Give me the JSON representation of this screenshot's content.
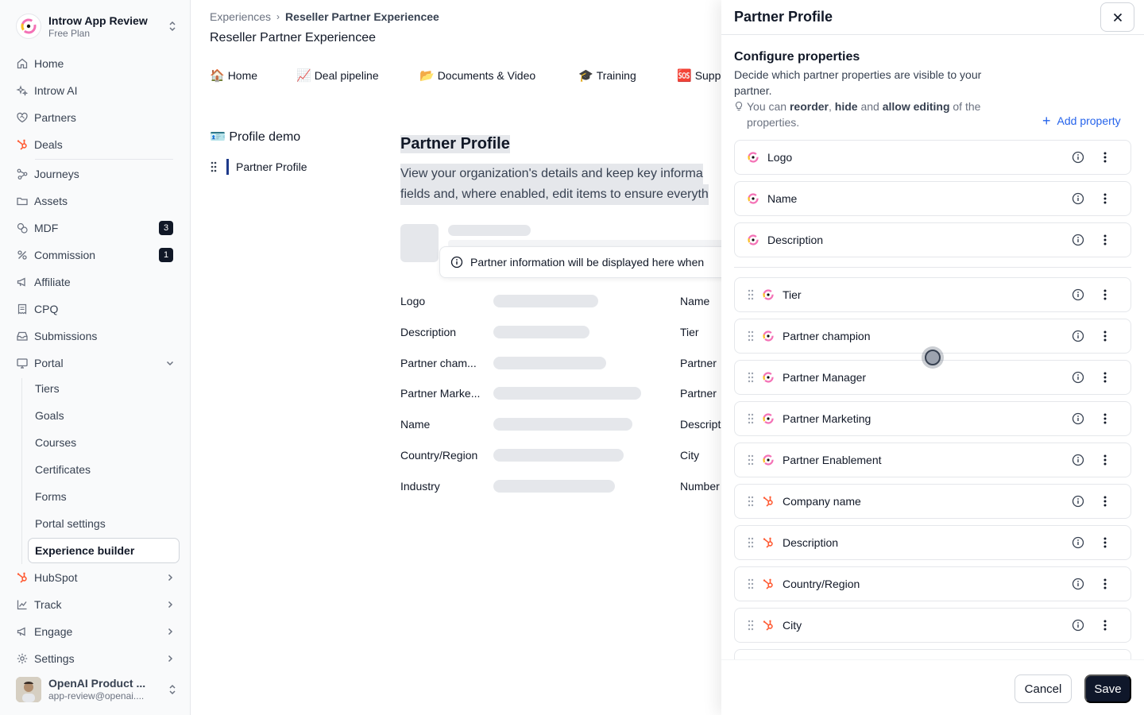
{
  "workspace": {
    "name": "Introw App Review",
    "plan": "Free Plan"
  },
  "sidebar": {
    "items": [
      {
        "label": "Home",
        "icon": "home-icon"
      },
      {
        "label": "Introw AI",
        "icon": "sparkle-icon"
      },
      {
        "label": "Partners",
        "icon": "handshake-icon"
      },
      {
        "label": "Deals",
        "icon": "hubspot-icon"
      },
      {
        "label": "Journeys",
        "icon": "journeys-icon"
      },
      {
        "label": "Assets",
        "icon": "folder-icon"
      },
      {
        "label": "MDF",
        "icon": "coins-icon",
        "badge": "3"
      },
      {
        "label": "Commission",
        "icon": "percent-icon",
        "badge": "1"
      },
      {
        "label": "Affiliate",
        "icon": "megaphone-icon"
      },
      {
        "label": "CPQ",
        "icon": "receipt-icon"
      },
      {
        "label": "Submissions",
        "icon": "inbox-icon"
      },
      {
        "label": "Portal",
        "icon": "monitor-icon"
      }
    ],
    "portal_sub": [
      "Tiers",
      "Goals",
      "Courses",
      "Certificates",
      "Forms",
      "Portal settings",
      "Experience builder"
    ],
    "bottom": [
      {
        "label": "HubSpot",
        "icon": "hubspot-icon"
      },
      {
        "label": "Track",
        "icon": "chart-icon"
      },
      {
        "label": "Engage",
        "icon": "megaphone-icon"
      },
      {
        "label": "Settings",
        "icon": "gear-icon"
      }
    ],
    "user": {
      "name": "OpenAI Product ...",
      "email": "app-review@openai...."
    }
  },
  "main": {
    "breadcrumb": {
      "parent": "Experiences",
      "current": "Reseller Partner Experiencee"
    },
    "title": "Reseller Partner Experiencee",
    "tabs": [
      {
        "emoji": "🏠",
        "label": "Home"
      },
      {
        "emoji": "📈",
        "label": "Deal pipeline"
      },
      {
        "emoji": "📂",
        "label": "Documents & Video"
      },
      {
        "emoji": "🎓",
        "label": "Training"
      },
      {
        "emoji": "🆘",
        "label": "Supp"
      }
    ],
    "left_panel": {
      "title_emoji": "🪪",
      "title": "Profile demo",
      "item": "Partner Profile"
    },
    "preview": {
      "title": "Partner Profile",
      "desc_line1": "View your organization's details and keep key informa",
      "desc_line2": "fields and, where enabled, edit items to ensure everyth",
      "info_message": "Partner information will be displayed here when",
      "fields_left": [
        "Logo",
        "Description",
        "Partner cham...",
        "Partner Marke...",
        "Name",
        "Country/Region",
        "Industry"
      ],
      "fields_right": [
        "Name",
        "Tier",
        "Partner",
        "Partner",
        "Descript",
        "City",
        "Number"
      ]
    }
  },
  "drawer": {
    "title": "Partner Profile",
    "config_title": "Configure properties",
    "config_desc": "Decide which partner properties are visible to your partner.",
    "hint": {
      "pre": "You can ",
      "reorder": "reorder",
      "mid1": ", ",
      "hide": "hide",
      "mid2": " and ",
      "allow": "allow editing",
      "post": " of the properties."
    },
    "add_property": "Add property",
    "fixed_properties": [
      {
        "label": "Logo",
        "source": "introw"
      },
      {
        "label": "Name",
        "source": "introw"
      },
      {
        "label": "Description",
        "source": "introw"
      }
    ],
    "properties": [
      {
        "label": "Tier",
        "source": "introw"
      },
      {
        "label": "Partner champion",
        "source": "introw"
      },
      {
        "label": "Partner Manager",
        "source": "introw"
      },
      {
        "label": "Partner Marketing",
        "source": "introw"
      },
      {
        "label": "Partner Enablement",
        "source": "introw"
      },
      {
        "label": "Company name",
        "source": "hubspot"
      },
      {
        "label": "Description",
        "source": "hubspot"
      },
      {
        "label": "Country/Region",
        "source": "hubspot"
      },
      {
        "label": "City",
        "source": "hubspot"
      }
    ],
    "cancel_label": "Cancel",
    "save_label": "Save"
  },
  "colors": {
    "accent_blue": "#2563eb",
    "hubspot_orange": "#ff5c35",
    "dark": "#0f172a"
  }
}
